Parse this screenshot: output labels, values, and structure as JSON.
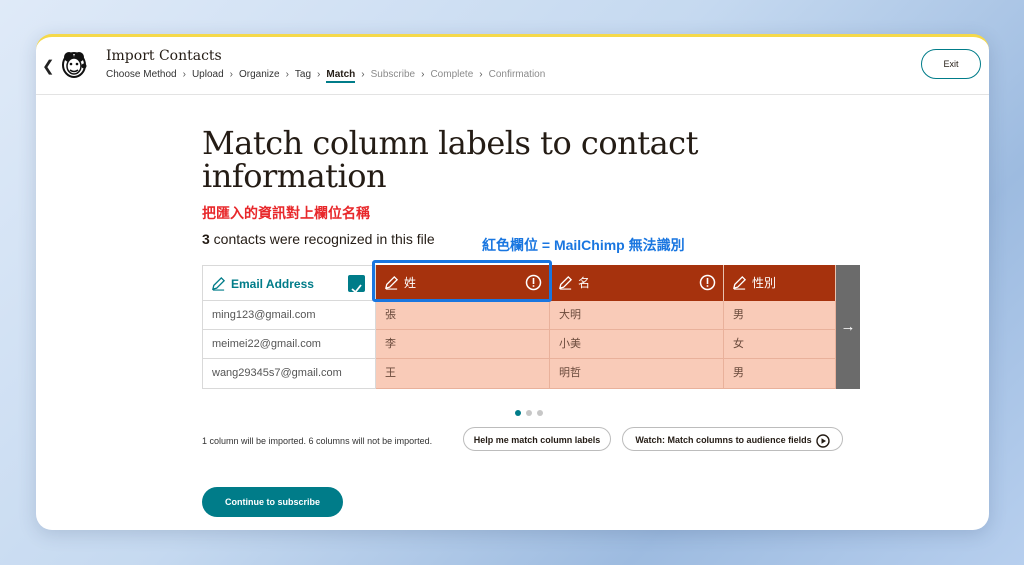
{
  "header": {
    "title": "Import Contacts",
    "breadcrumb": [
      "Choose Method",
      "Upload",
      "Organize",
      "Tag",
      "Match",
      "Subscribe",
      "Complete",
      "Confirmation"
    ],
    "exit_label": "Exit"
  },
  "main": {
    "title": "Match column labels to contact information",
    "note_red": "把匯入的資訊對上欄位名稱",
    "recognized_count": "3",
    "recognized_text": " contacts were recognized in this file",
    "note_blue": "紅色欄位 = MailChimp 無法識別"
  },
  "table": {
    "headers": [
      "Email Address",
      "姓",
      "名",
      "性別"
    ],
    "rows": [
      [
        "ming123@gmail.com",
        "張",
        "大明",
        "男"
      ],
      [
        "meimei22@gmail.com",
        "李",
        "小美",
        "女"
      ],
      [
        "wang29345s7@gmail.com",
        "王",
        "明哲",
        "男"
      ]
    ]
  },
  "footer": {
    "import_note": "1 column will be imported. 6 columns will not be imported.",
    "help_label": "Help me match column labels",
    "watch_label": "Watch: Match columns to audience fields",
    "continue_label": "Continue to subscribe"
  },
  "colors": {
    "accent": "#007c89",
    "unmatched_header": "#a6320d",
    "unmatched_cell": "#f9cbb8",
    "annotation_red": "#e8282b",
    "annotation_blue": "#1976e0"
  }
}
